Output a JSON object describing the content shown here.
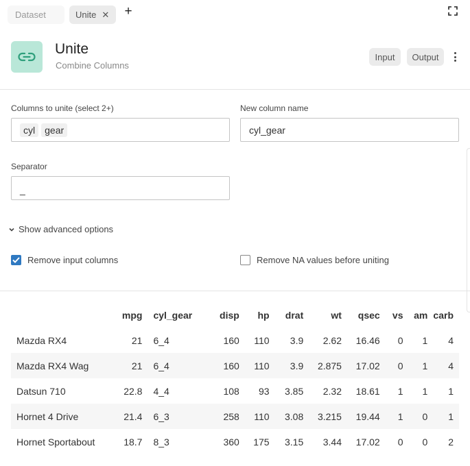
{
  "tabs": [
    {
      "label": "Dataset"
    },
    {
      "label": "Unite",
      "close": "✕"
    }
  ],
  "add_tab_label": "+",
  "header": {
    "title": "Unite",
    "subtitle": "Combine Columns",
    "input_label": "Input",
    "output_label": "Output"
  },
  "form": {
    "columns_label": "Columns to unite (select 2+)",
    "columns_selected": [
      "cyl",
      "gear"
    ],
    "new_name_label": "New column name",
    "new_name_value": "cyl_gear",
    "separator_label": "Separator",
    "separator_value": "_",
    "advanced_label": "Show advanced options",
    "remove_input_label": "Remove input columns",
    "remove_input_checked": true,
    "remove_na_label": "Remove NA values before uniting",
    "remove_na_checked": false
  },
  "colors": {
    "accent": "#2f79c1",
    "icon_bg": "#b9e7d8",
    "icon_fg": "#2e9f7c"
  },
  "table": {
    "headers": [
      "",
      "mpg",
      "cyl_gear",
      "disp",
      "hp",
      "drat",
      "wt",
      "qsec",
      "vs",
      "am",
      "carb"
    ],
    "rows": [
      [
        "Mazda RX4",
        "21",
        "6_4",
        "160",
        "110",
        "3.9",
        "2.62",
        "16.46",
        "0",
        "1",
        "4"
      ],
      [
        "Mazda RX4 Wag",
        "21",
        "6_4",
        "160",
        "110",
        "3.9",
        "2.875",
        "17.02",
        "0",
        "1",
        "4"
      ],
      [
        "Datsun 710",
        "22.8",
        "4_4",
        "108",
        "93",
        "3.85",
        "2.32",
        "18.61",
        "1",
        "1",
        "1"
      ],
      [
        "Hornet 4 Drive",
        "21.4",
        "6_3",
        "258",
        "110",
        "3.08",
        "3.215",
        "19.44",
        "1",
        "0",
        "1"
      ],
      [
        "Hornet Sportabout",
        "18.7",
        "8_3",
        "360",
        "175",
        "3.15",
        "3.44",
        "17.02",
        "0",
        "0",
        "2"
      ]
    ]
  }
}
